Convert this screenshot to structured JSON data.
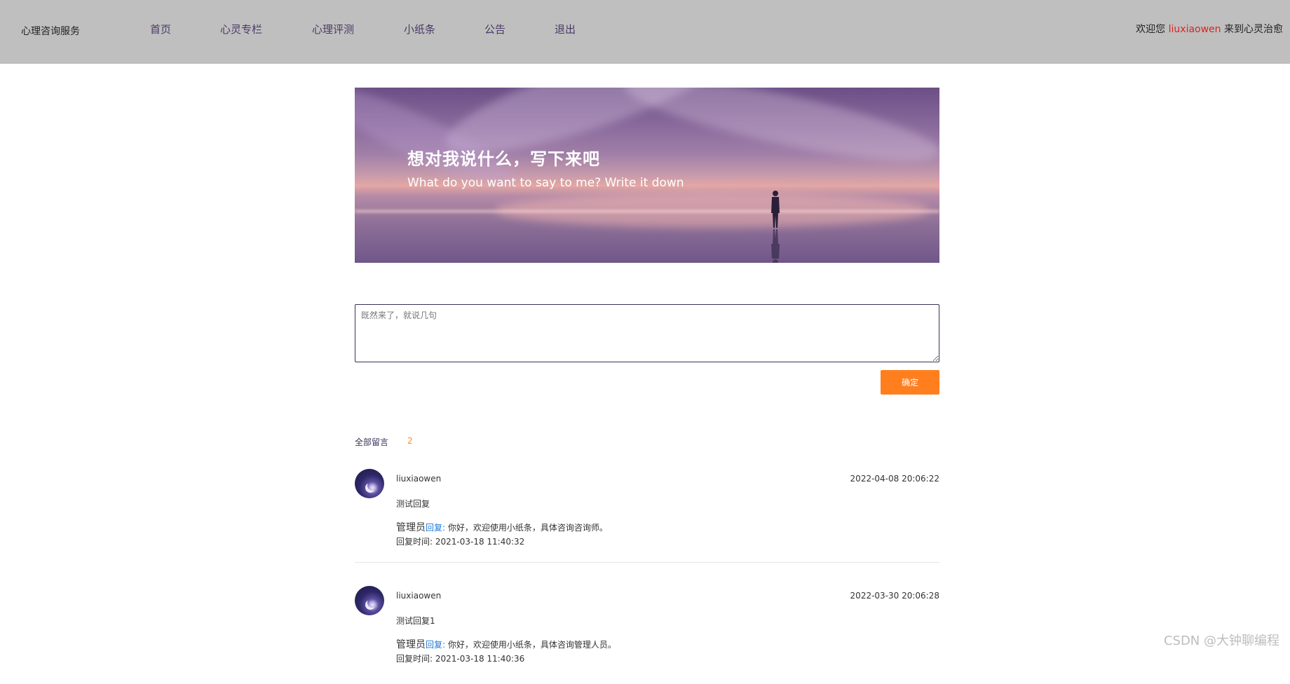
{
  "header": {
    "brand": "心理咨询服务",
    "nav": [
      {
        "label": "首页"
      },
      {
        "label": "心灵专栏"
      },
      {
        "label": "心理评测"
      },
      {
        "label": "小纸条"
      },
      {
        "label": "公告"
      },
      {
        "label": "退出"
      }
    ],
    "welcome_prefix": "欢迎您",
    "username": "liuxiaowen",
    "welcome_suffix": "来到心灵治愈"
  },
  "banner": {
    "title": "想对我说什么，写下来吧",
    "subtitle": "What do you want to say to me? Write it down"
  },
  "form": {
    "placeholder": "既然来了，就说几句",
    "value": "",
    "submit_label": "确定"
  },
  "comments": {
    "header_label": "全部留言",
    "count": "2",
    "items": [
      {
        "author": "liuxiaowen",
        "time": "2022-04-08 20:06:22",
        "content": "测试回复",
        "reply_author": "管理员",
        "reply_link": "回复:",
        "reply_text": " 你好，欢迎使用小纸条，具体咨询咨询师。",
        "reply_time_label": "回复时间: ",
        "reply_time": "2021-03-18 11:40:32"
      },
      {
        "author": "liuxiaowen",
        "time": "2022-03-30 20:06:28",
        "content": "测试回复1",
        "reply_author": "管理员",
        "reply_link": "回复:",
        "reply_text": " 你好，欢迎使用小纸条，具体咨询管理人员。",
        "reply_time_label": "回复时间: ",
        "reply_time": "2021-03-18 11:40:36"
      }
    ]
  },
  "watermark": "CSDN @大钟聊编程",
  "colors": {
    "header_bg": "#bfbfbf",
    "nav_text": "#4a3a66",
    "username": "#e02020",
    "button": "#ff7f1f",
    "count": "#ff8a1f",
    "reply_link": "#1e7ad6"
  }
}
